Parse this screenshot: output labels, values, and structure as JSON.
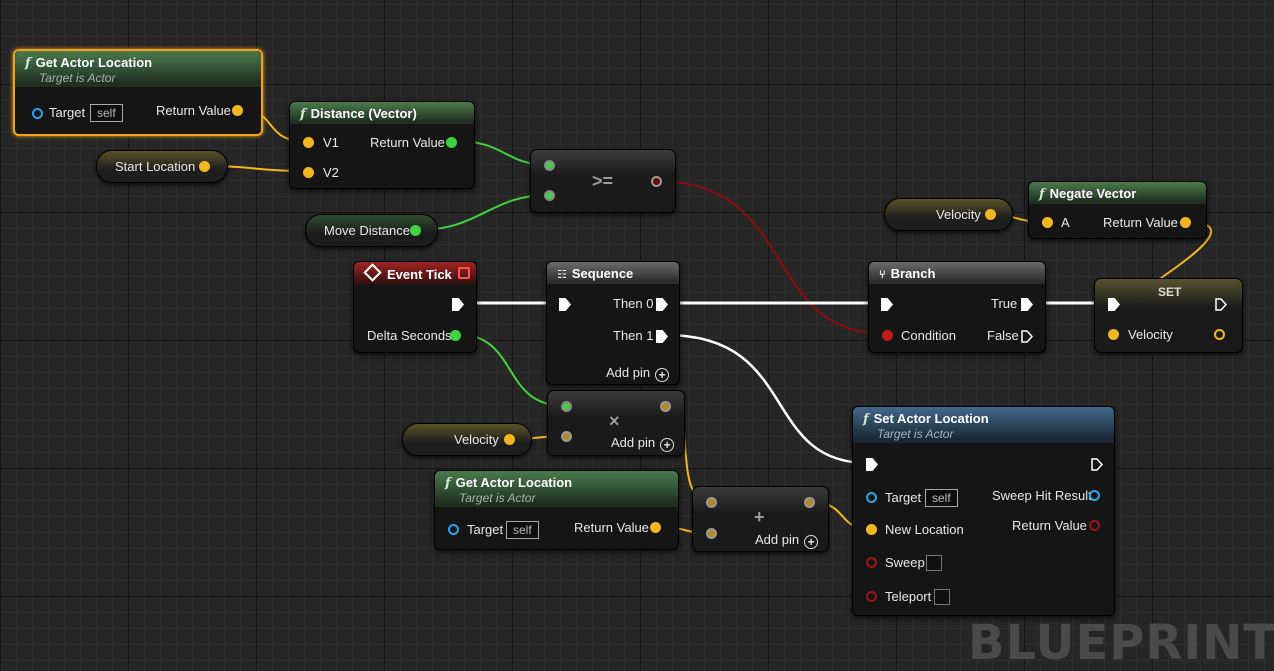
{
  "watermark": "BLUEPRINT",
  "colors": {
    "exec_wire": "#ffffff",
    "vector_wire": "#f2b623",
    "float_wire": "#3fd13f",
    "bool_wire": "#8c0d0d",
    "selected_outline": "#f1a21b"
  },
  "nodes": {
    "get_actor_location_1": {
      "title": "Get Actor Location",
      "subtitle": "Target is Actor",
      "target_label": "Target",
      "target_value": "self",
      "return_label": "Return Value"
    },
    "distance": {
      "title": "Distance (Vector)",
      "v1_label": "V1",
      "v2_label": "V2",
      "return_label": "Return Value"
    },
    "start_location": {
      "label": "Start Location"
    },
    "move_distance": {
      "label": "Move Distance"
    },
    "compare": {
      "symbol": ">="
    },
    "event_tick": {
      "title": "Event Tick",
      "delta_label": "Delta Seconds"
    },
    "sequence": {
      "title": "Sequence",
      "then0_label": "Then 0",
      "then1_label": "Then 1",
      "add_pin_label": "Add pin"
    },
    "branch": {
      "title": "Branch",
      "condition_label": "Condition",
      "true_label": "True",
      "false_label": "False"
    },
    "velocity_1": {
      "label": "Velocity"
    },
    "negate_vector": {
      "title": "Negate Vector",
      "a_label": "A",
      "return_label": "Return Value"
    },
    "set_velocity": {
      "title": "SET",
      "velocity_label": "Velocity"
    },
    "multiply": {
      "symbol": "×",
      "add_pin_label": "Add pin"
    },
    "velocity_2": {
      "label": "Velocity"
    },
    "get_actor_location_2": {
      "title": "Get Actor Location",
      "subtitle": "Target is Actor",
      "target_label": "Target",
      "target_value": "self",
      "return_label": "Return Value"
    },
    "add": {
      "symbol": "+",
      "add_pin_label": "Add pin"
    },
    "set_actor_location": {
      "title": "Set Actor Location",
      "subtitle": "Target is Actor",
      "target_label": "Target",
      "target_value": "self",
      "new_location_label": "New Location",
      "sweep_label": "Sweep",
      "teleport_label": "Teleport",
      "sweep_hit_label": "Sweep Hit Result",
      "return_label": "Return Value"
    }
  }
}
